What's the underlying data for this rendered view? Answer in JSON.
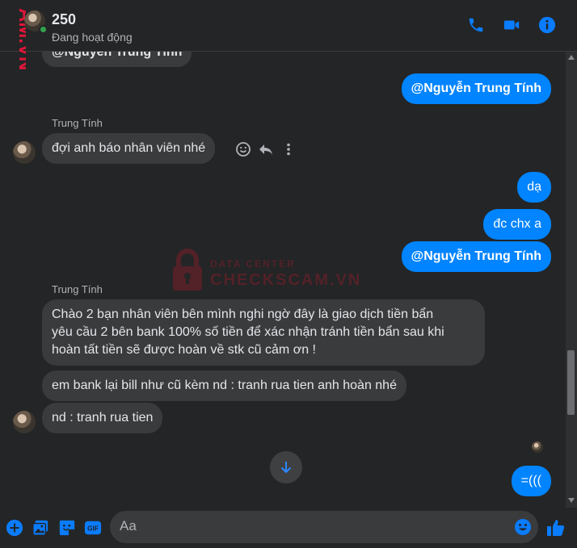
{
  "header": {
    "name": "250",
    "status": "Đang hoạt động"
  },
  "side_watermark": "AM.VN",
  "watermark": {
    "small": "DATA CENTER",
    "big": "CHECKSCAM.VN"
  },
  "messages": {
    "m0_partial": "@Nguyễn Trung Tính",
    "m1_out": "@Nguyễn Trung Tính",
    "sender1": "Trung Tính",
    "m2_in": "đợi anh báo nhân viên nhé",
    "m3_out": "dạ",
    "m4_out": "đc chx a",
    "m5_out": "@Nguyễn Trung Tính",
    "sender2": "Trung Tính",
    "m6_in_line1": "Chào 2 bạn nhân viên bên mình nghi ngờ đây là giao dịch tiền bẩn",
    "m6_in_line2": "yêu cầu 2 bên bank 100% số tiền để xác nhận tránh tiền bẩn sau khi",
    "m6_in_line3": "hoàn tất tiền sẽ được hoàn về stk cũ cảm ơn !",
    "m7_in": "em bank lại bill như cũ kèm nd : tranh rua tien anh hoàn nhé",
    "m8_in": "nd : tranh rua tien",
    "m9_out": "=((("
  },
  "composer": {
    "placeholder": "Aa"
  },
  "icons": {
    "call": "phone-icon",
    "video": "video-camera-icon",
    "info": "info-icon",
    "react": "smiley-icon",
    "reply": "reply-arrow-icon",
    "more": "more-vertical-icon",
    "jump": "arrow-down-icon",
    "plus": "plus-circle-icon",
    "image": "image-gallery-icon",
    "sticker": "sticker-icon",
    "gif": "gif-icon",
    "emoji": "emoji-icon",
    "like": "thumbs-up-icon"
  },
  "colors": {
    "accent": "#0084ff",
    "background": "#242526",
    "incoming_bubble": "#3a3b3c",
    "online": "#31a24c"
  }
}
